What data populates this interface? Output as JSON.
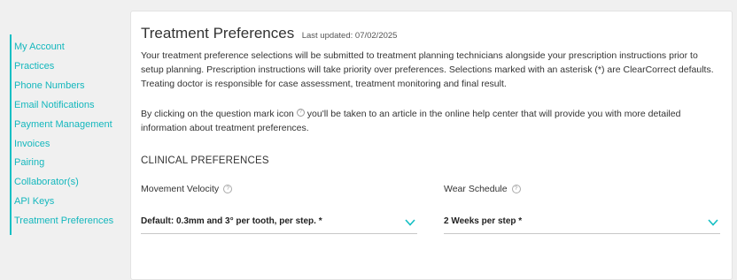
{
  "sidebar": {
    "items": [
      {
        "label": "My Account"
      },
      {
        "label": "Practices"
      },
      {
        "label": "Phone Numbers"
      },
      {
        "label": "Email Notifications"
      },
      {
        "label": "Payment Management"
      },
      {
        "label": "Invoices"
      },
      {
        "label": "Pairing"
      },
      {
        "label": "Collaborator(s)"
      },
      {
        "label": "API Keys"
      },
      {
        "label": "Treatment Preferences"
      }
    ]
  },
  "header": {
    "title": "Treatment Preferences",
    "last_updated_label": "Last updated:",
    "last_updated_date": "07/02/2025"
  },
  "intro": {
    "paragraph1": "Your treatment preference selections will be submitted to treatment planning technicians alongside your prescription instructions prior to setup planning. Prescription instructions will take priority over preferences. Selections marked with an asterisk (*) are ClearCorrect defaults. Treating doctor is responsible for case assessment, treatment monitoring and final result.",
    "paragraph2_before": "By clicking on the question mark icon",
    "paragraph2_after": "you'll be taken to an article in the online help center that will provide you with more detailed information about treatment preferences."
  },
  "clinical": {
    "section_title": "CLINICAL PREFERENCES",
    "movement_velocity": {
      "label": "Movement Velocity",
      "value": "Default: 0.3mm and 3° per tooth, per step. *"
    },
    "wear_schedule": {
      "label": "Wear Schedule",
      "value": "2 Weeks per step *"
    }
  },
  "icons": {
    "help": "question-mark-icon",
    "dropdown": "chevron-down-icon"
  },
  "colors": {
    "accent": "#13bfc4",
    "link": "#13b7bd"
  }
}
